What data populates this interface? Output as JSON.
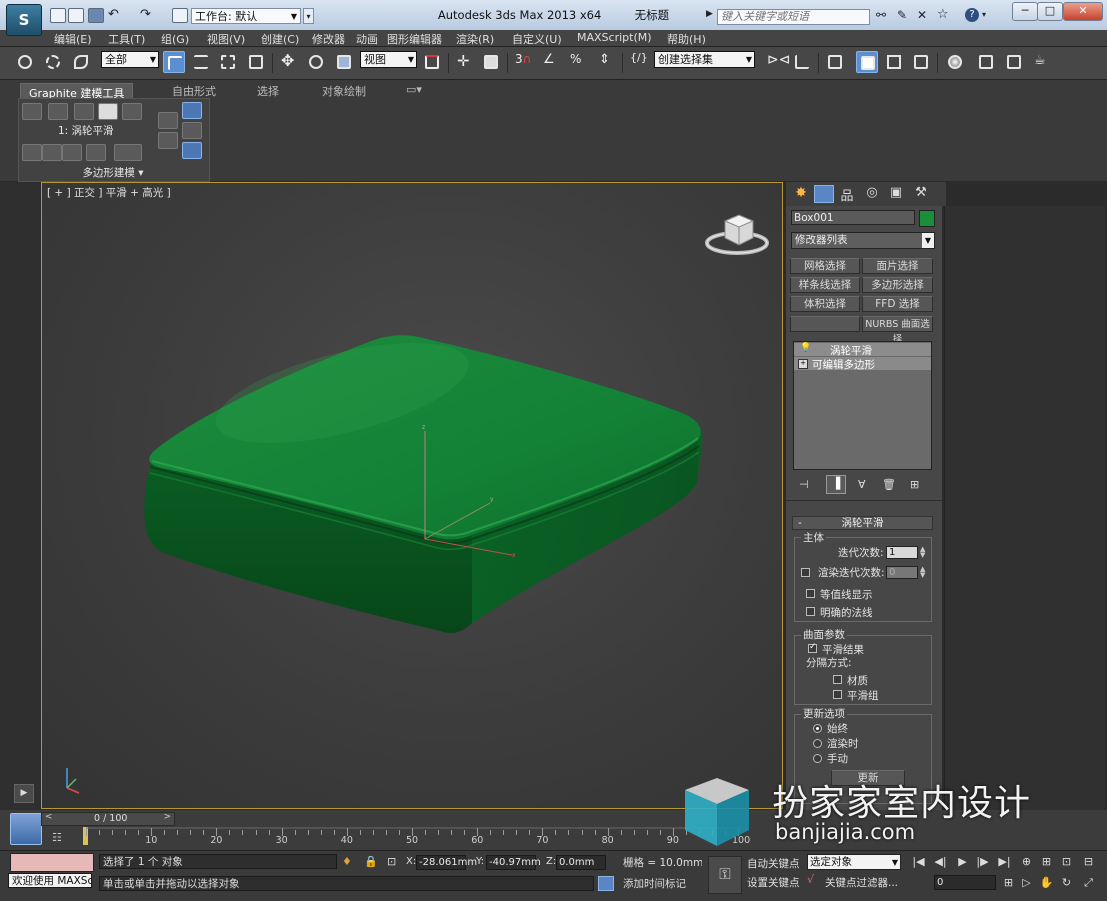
{
  "app": {
    "title": "Autodesk 3ds Max  2013 x64",
    "doc_title": "无标题",
    "workspace_label": "工作台: 默认",
    "search_placeholder": "键入关键字或短语",
    "window_buttons": [
      "─",
      "□",
      "✕"
    ]
  },
  "menu": [
    "编辑(E)",
    "工具(T)",
    "组(G)",
    "视图(V)",
    "创建(C)",
    "修改器",
    "动画",
    "图形编辑器",
    "渲染(R)",
    "自定义(U)",
    "MAXScript(M)",
    "帮助(H)"
  ],
  "toolbar": {
    "selection_filter": "全部",
    "ref_coord": "视图",
    "named_selection": "创建选择集"
  },
  "ribbon": {
    "tabs": [
      "Graphite 建模工具",
      "自由形式",
      "选择",
      "对象绘制"
    ],
    "panel_label": "1: 涡轮平滑",
    "panel_title": "多边形建模 ▾"
  },
  "viewport": {
    "label": "[ + ] 正交 ] 平滑 + 高光 ]",
    "object_color": "#0f7a2f"
  },
  "command_panel": {
    "object_name": "Box001",
    "object_color": "#1a8f3a",
    "modifier_list": "修改器列表",
    "modifier_buttons": [
      {
        "label": "网格选择"
      },
      {
        "label": "面片选择"
      },
      {
        "label": "样条线选择"
      },
      {
        "label": "多边形选择"
      },
      {
        "label": "体积选择"
      },
      {
        "label": "FFD 选择"
      },
      {
        "label": ""
      },
      {
        "label": "NURBS 曲面选择"
      }
    ],
    "stack": [
      "涡轮平滑",
      "可编辑多边形"
    ],
    "rollout_title": "涡轮平滑",
    "main_group": "主体",
    "iterations_label": "迭代次数:",
    "iterations_value": "1",
    "render_iters_label": "渲染迭代次数:",
    "render_iters_value": "0",
    "isoline_label": "等值线显示",
    "explicit_normals_label": "明确的法线",
    "surface_group": "曲面参数",
    "smooth_result_label": "平滑结果",
    "separate_label": "分隔方式:",
    "material_label": "材质",
    "smooth_groups_label": "平滑组",
    "update_group": "更新选项",
    "update_options": [
      "始终",
      "渲染时",
      "手动"
    ],
    "update_button": "更新"
  },
  "timeline": {
    "frame_display": "0 / 100",
    "labels": [
      "10",
      "20",
      "30",
      "40",
      "50",
      "60",
      "70",
      "80",
      "90",
      "100"
    ]
  },
  "status": {
    "welcome": "欢迎使用 MAXSc",
    "selected": "选择了 1 个 对象",
    "prompt": "单击或单击并拖动以选择对象",
    "x_label": "X:",
    "x_value": "-28.061mm",
    "y_label": "Y:",
    "y_value": "-40.97mm",
    "z_label": "Z:",
    "z_value": "0.0mm",
    "grid": "栅格 = 10.0mm",
    "add_time_tag": "添加时间标记",
    "auto_key": "自动关键点",
    "set_key": "设置关键点",
    "selected_obj": "选定对象",
    "key_filters": "关键点过滤器...",
    "current_frame": "0"
  },
  "watermark": {
    "brand": "扮家家室内设计",
    "url": "banjiajia.com"
  }
}
